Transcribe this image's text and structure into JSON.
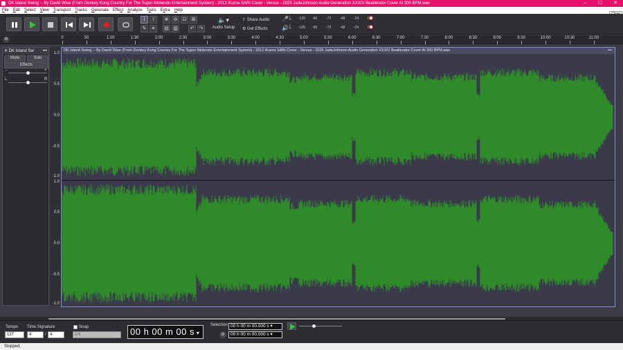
{
  "window": {
    "title": "DK Island Swing -- By David Wise (From Donkey Kong Country For The Super Nintendo Entertainment System) - 2012 iKuma SARi Cover - Versus - 2025 JadeJohnson Audio Generation XXXIV Beatlerator Cover At 300 BPM.wav",
    "controls": [
      "–",
      "☐",
      "✕"
    ],
    "close_tooltip": "Close"
  },
  "menu": [
    {
      "label": "File",
      "u": "F",
      "rest": "ile"
    },
    {
      "label": "Edit",
      "u": "E",
      "rest": "dit"
    },
    {
      "label": "Select",
      "u": "S",
      "rest": "elect"
    },
    {
      "label": "View",
      "u": "V",
      "rest": "iew"
    },
    {
      "label": "Transport",
      "u": "T",
      "rest": "ransport"
    },
    {
      "label": "Tracks",
      "u": "T",
      "rest": "racks"
    },
    {
      "label": "Generate",
      "u": "G",
      "rest": "enerate"
    },
    {
      "label": "Effect",
      "u": "c",
      "pre": "Effe",
      "rest": "t"
    },
    {
      "label": "Analyze",
      "u": "A",
      "rest": "nalyze"
    },
    {
      "label": "Tools",
      "u": "o",
      "pre": "T",
      "rest": "ols"
    },
    {
      "label": "Extra",
      "u": "x",
      "pre": "E",
      "rest": "tra"
    },
    {
      "label": "Help",
      "u": "H",
      "rest": "elp"
    }
  ],
  "toolbar": {
    "audio_setup": "Audio Setup",
    "share_audio": "Share Audio",
    "get_effects": "Get Effects",
    "rec_meter_ticks": [
      "-120",
      "-96",
      "-72",
      "-48",
      "-24",
      "0"
    ],
    "play_meter_ticks": [
      "-120",
      "-96",
      "-72",
      "-48",
      "-24",
      "0"
    ],
    "rec_channels": "L R",
    "play_channels": "L R"
  },
  "timeline": {
    "ticks": [
      "0",
      "30",
      "1:00",
      "1:30",
      "2:00",
      "2:30",
      "3:00",
      "3:30",
      "4:00",
      "4:30",
      "5:00",
      "5:30",
      "6:00",
      "6:30",
      "7:00",
      "7:30",
      "8:00",
      "8:30",
      "9:00",
      "9:30",
      "10:00",
      "10:30",
      "11:00"
    ]
  },
  "track": {
    "name": "DK Island Sw",
    "mute": "Mute",
    "solo": "Solo",
    "effects": "Effects",
    "gain_minus": "-",
    "gain_plus": "+",
    "gain_level": 0.5,
    "pan_left": "L",
    "pan_right": "R",
    "pan_level": 0.5,
    "clip_name": "DK Island Swing -- By David Wise (From Donkey Kong Country For The Super Nintendo Entertainment System) - 2012 iKuma SARi Cover - Versus - 2025 JadeJohnson Audio Generation XXXIV Beatlerator Cover At 300 BPM.wav",
    "clip_menu": "•••",
    "ch1_labels": [
      "1.0",
      "0.5",
      "0.0",
      "-0.5",
      "-1.0"
    ],
    "ch2_labels": [
      "1.0",
      "0.5",
      "0.0",
      "-0.5",
      "-1.0"
    ],
    "wave_color": "#2f8a2a"
  },
  "bottom": {
    "tempo_label": "Tempo",
    "tempo_value": "137",
    "timesig_label": "Time Signature",
    "timesig_num": "4",
    "timesig_slash": "/",
    "timesig_den": "4",
    "snap_label": "Snap",
    "snap_value": "1/4",
    "time": "00 h 00 m 00 s",
    "selection_label": "Selection",
    "sel_start": "00 h 00 m 00.000 s",
    "sel_end": "00 h 00 m 00.000 s",
    "play_at_speed_level": 0.35
  },
  "status": {
    "text": "Stopped."
  },
  "colors": {
    "title_bar": "#e8106a",
    "waveform": "#2f8a2a",
    "record": "#e02020",
    "play": "#38c238"
  }
}
